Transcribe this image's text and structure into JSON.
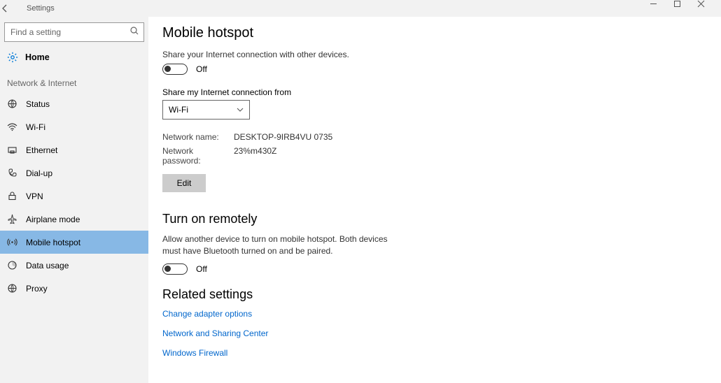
{
  "titlebar": {
    "title": "Settings"
  },
  "sidebar": {
    "search_placeholder": "Find a setting",
    "home": "Home",
    "category": "Network & Internet",
    "items": [
      {
        "label": "Status"
      },
      {
        "label": "Wi-Fi"
      },
      {
        "label": "Ethernet"
      },
      {
        "label": "Dial-up"
      },
      {
        "label": "VPN"
      },
      {
        "label": "Airplane mode"
      },
      {
        "label": "Mobile hotspot"
      },
      {
        "label": "Data usage"
      },
      {
        "label": "Proxy"
      }
    ]
  },
  "main": {
    "title": "Mobile hotspot",
    "share_desc": "Share your Internet connection with other devices.",
    "toggle1_state": "Off",
    "share_from_label": "Share my Internet connection from",
    "share_from_value": "Wi-Fi",
    "network_name_label": "Network name:",
    "network_name_value": "DESKTOP-9IRB4VU 0735",
    "network_pw_label": "Network password:",
    "network_pw_value": "23%m430Z",
    "edit_btn": "Edit",
    "remote_title": "Turn on remotely",
    "remote_desc": "Allow another device to turn on mobile hotspot. Both devices must have Bluetooth turned on and be paired.",
    "toggle2_state": "Off",
    "related_title": "Related settings",
    "links": [
      "Change adapter options",
      "Network and Sharing Center",
      "Windows Firewall"
    ]
  }
}
